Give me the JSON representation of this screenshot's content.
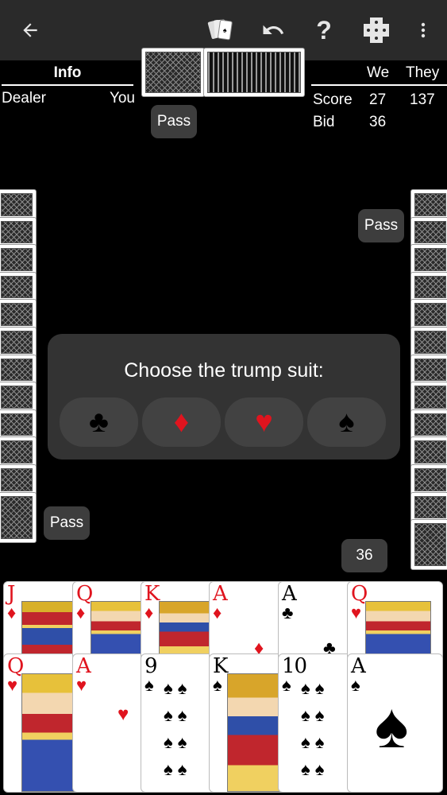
{
  "toolbar": {
    "back_icon": "arrow-left-icon",
    "cards_icon": "cards-icon",
    "undo_icon": "undo-icon",
    "help_icon": "help-icon",
    "help_glyph": "?",
    "dice_icon": "dice-icon",
    "menu_icon": "more-vert-icon"
  },
  "info": {
    "header": "Info",
    "dealer_label": "Dealer",
    "dealer_value": "You"
  },
  "score": {
    "col_we": "We",
    "col_they": "They",
    "score_label": "Score",
    "score_we": "27",
    "score_they": "137",
    "bid_label": "Bid",
    "bid_we": "36"
  },
  "bids": {
    "north": "Pass",
    "east": "Pass",
    "west": "Pass",
    "south": "36"
  },
  "dialog": {
    "title": "Choose the trump suit:",
    "suits": [
      {
        "name": "clubs",
        "glyph": "♣",
        "color": "#000000"
      },
      {
        "name": "diamonds",
        "glyph": "♦",
        "color": "#e0141e"
      },
      {
        "name": "hearts",
        "glyph": "♥",
        "color": "#e0141e"
      },
      {
        "name": "spades",
        "glyph": "♠",
        "color": "#000000"
      }
    ]
  },
  "hand": {
    "top_row": [
      {
        "rank": "J",
        "suit": "♦",
        "color": "red",
        "face": true
      },
      {
        "rank": "Q",
        "suit": "♦",
        "color": "red",
        "face": true
      },
      {
        "rank": "K",
        "suit": "♦",
        "color": "red",
        "face": true
      },
      {
        "rank": "A",
        "suit": "♦",
        "color": "red",
        "face": false
      },
      {
        "rank": "A",
        "suit": "♣",
        "color": "blk",
        "face": false
      },
      {
        "rank": "Q",
        "suit": "♥",
        "color": "red",
        "face": true
      }
    ],
    "bottom_row": [
      {
        "rank": "Q",
        "suit": "♥",
        "color": "red",
        "face": true
      },
      {
        "rank": "A",
        "suit": "♥",
        "color": "red",
        "face": false
      },
      {
        "rank": "9",
        "suit": "♠",
        "color": "blk",
        "face": false
      },
      {
        "rank": "K",
        "suit": "♠",
        "color": "blk",
        "face": true
      },
      {
        "rank": "10",
        "suit": "♠",
        "color": "blk",
        "face": false
      },
      {
        "rank": "A",
        "suit": "♠",
        "color": "blk",
        "face": false
      }
    ]
  },
  "colors": {
    "background": "#000000",
    "toolbar": "#2a2a2a",
    "pill": "#3d3d3d",
    "dialog": "#333333",
    "red_suit": "#e0141e"
  }
}
